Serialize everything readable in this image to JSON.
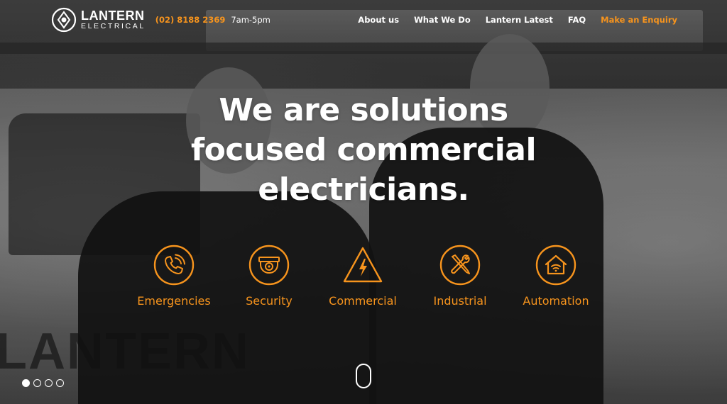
{
  "brand": {
    "name": "LANTERN",
    "sub": "ELECTRICAL",
    "accent_color": "#f7941d"
  },
  "contact": {
    "phone": "(02) 8188 2369",
    "hours": "7am-5pm"
  },
  "nav": {
    "items": [
      "About us",
      "What We Do",
      "Lantern Latest",
      "FAQ"
    ],
    "cta": "Make an Enquiry"
  },
  "hero": {
    "line1": "We are solutions",
    "line2": "focused commercial",
    "line3": "electricians."
  },
  "services": [
    {
      "label": "Emergencies",
      "icon": "phone-ringing-icon"
    },
    {
      "label": "Security",
      "icon": "security-camera-icon"
    },
    {
      "label": "Commercial",
      "icon": "warning-lightning-icon"
    },
    {
      "label": "Industrial",
      "icon": "tools-icon"
    },
    {
      "label": "Automation",
      "icon": "smart-home-icon"
    }
  ],
  "carousel": {
    "slide_count": 4,
    "active_slide": 1
  }
}
